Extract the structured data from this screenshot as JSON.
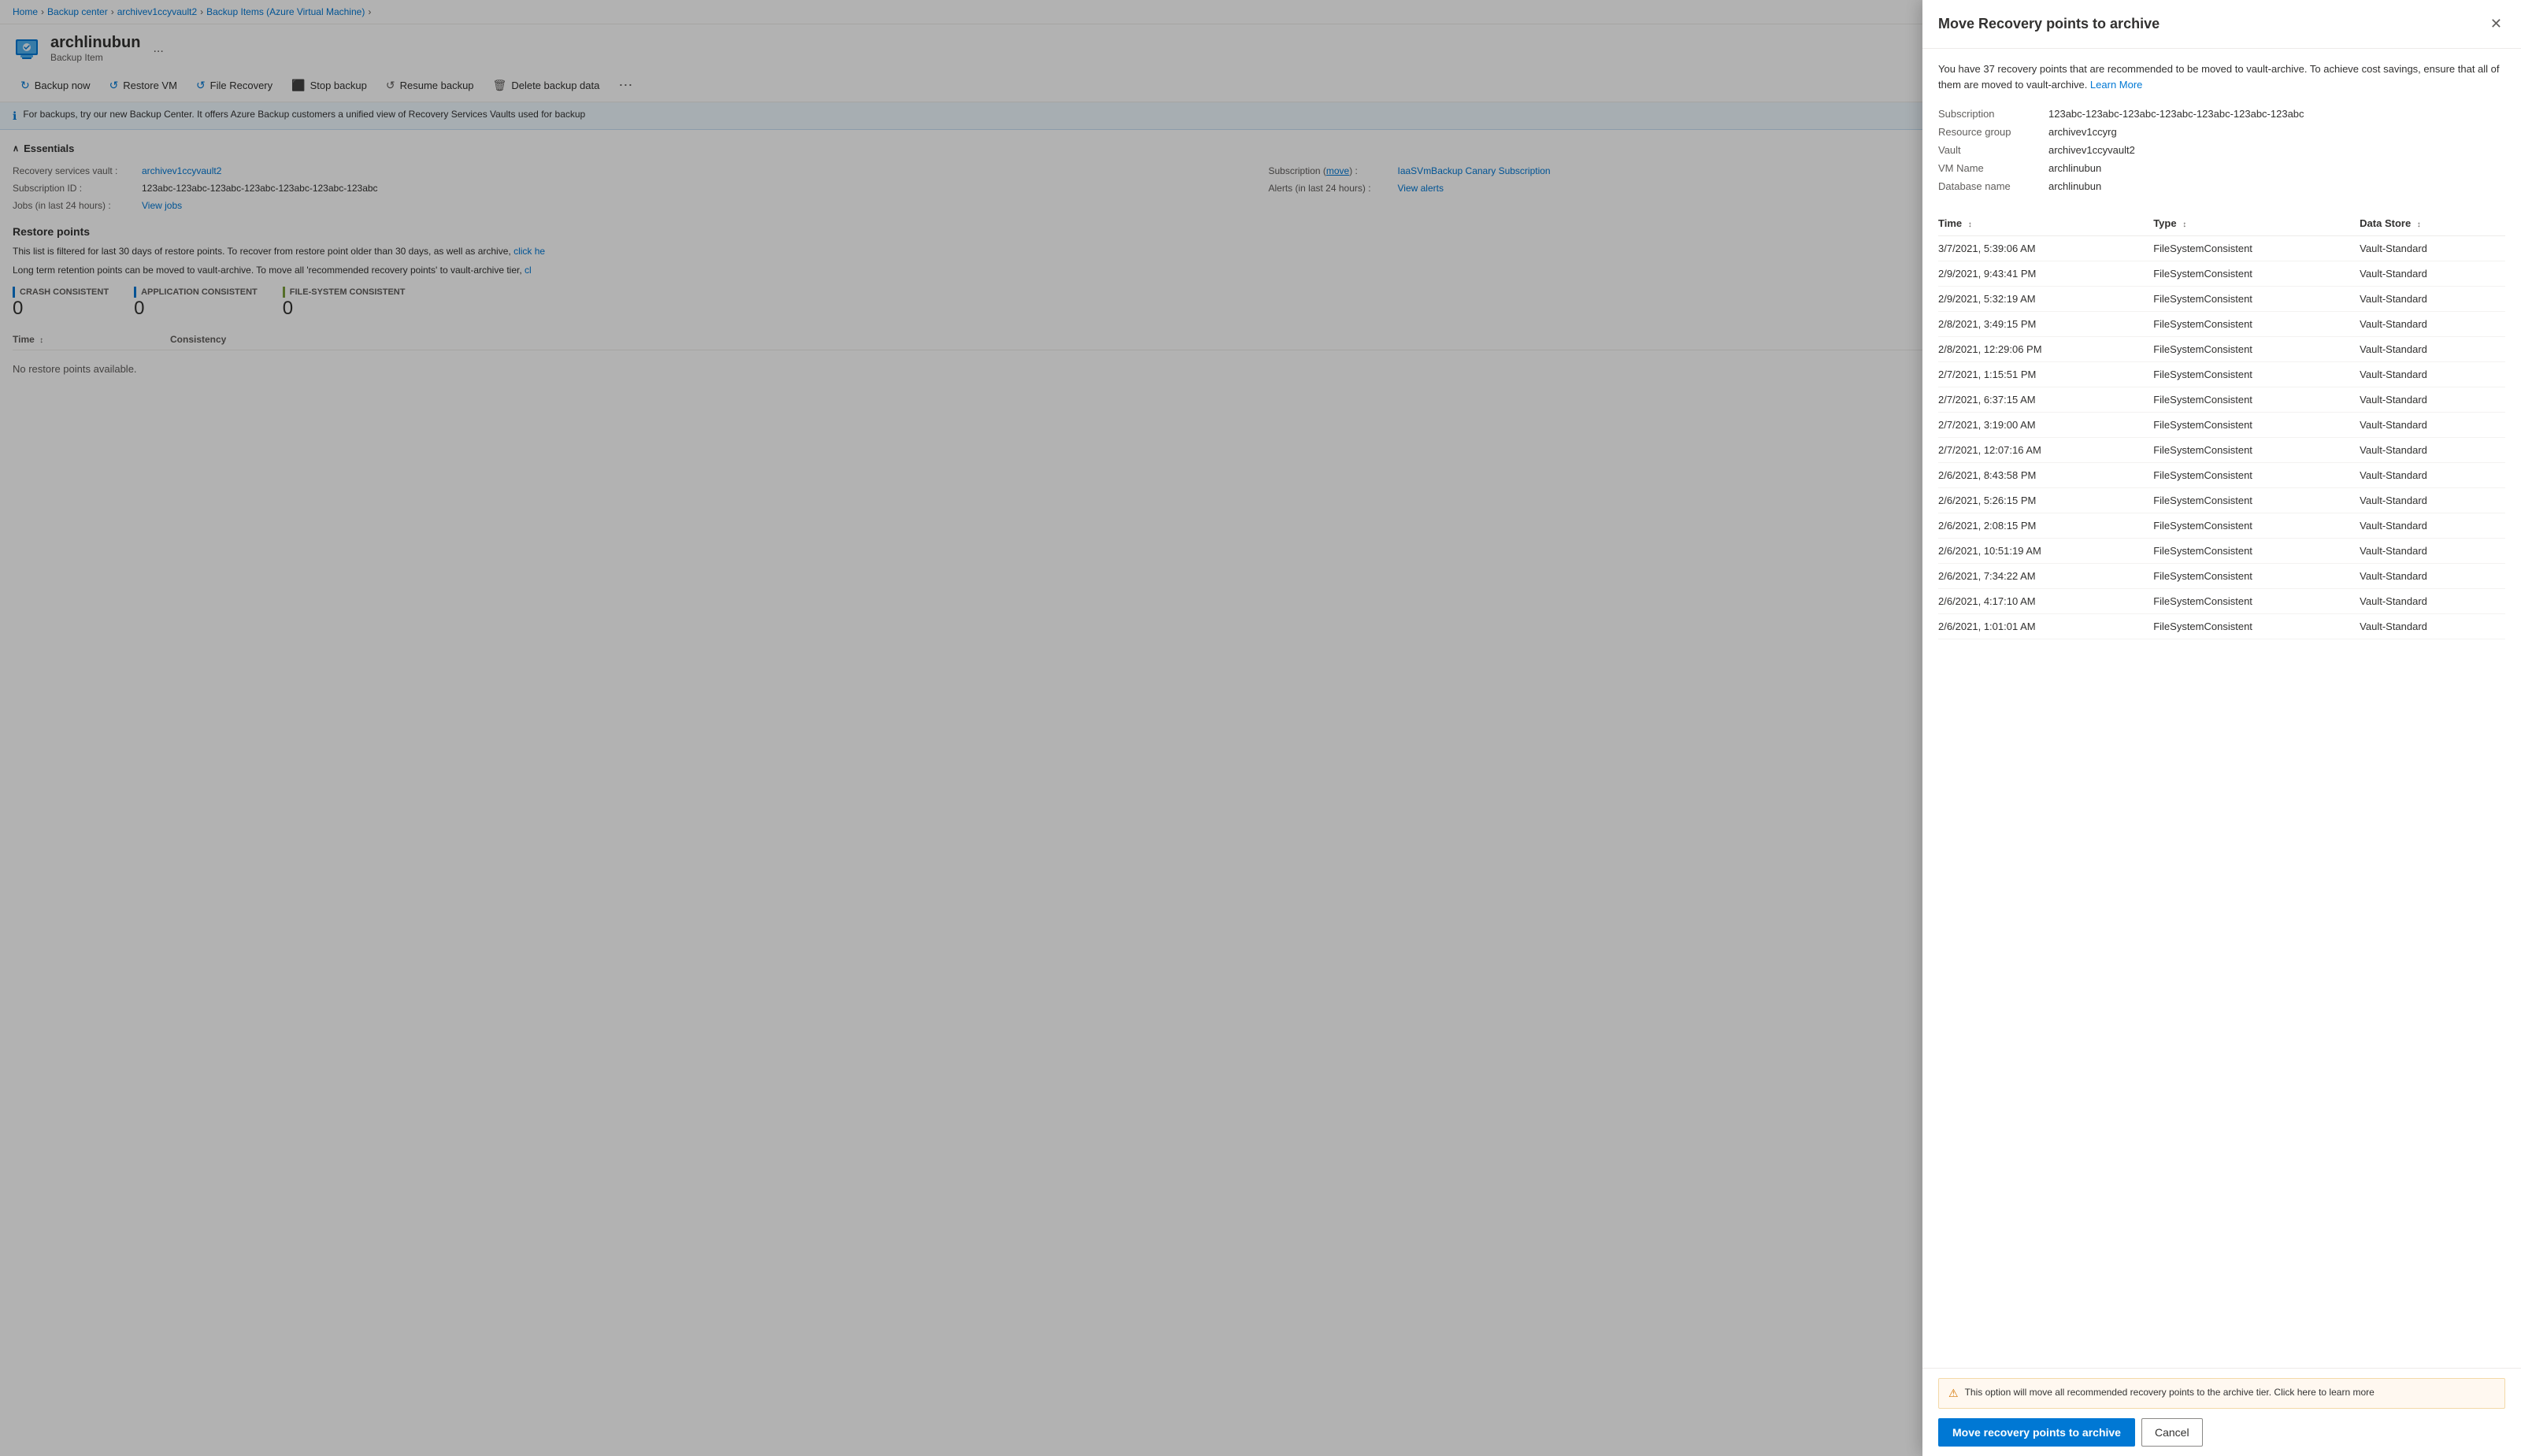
{
  "breadcrumb": {
    "items": [
      {
        "label": "Home",
        "href": "#"
      },
      {
        "label": "Backup center",
        "href": "#"
      },
      {
        "label": "archivev1ccyvault2",
        "href": "#"
      },
      {
        "label": "Backup Items (Azure Virtual Machine)",
        "href": "#"
      }
    ]
  },
  "header": {
    "title": "archlinubun",
    "subtitle": "Backup Item",
    "more_label": "..."
  },
  "toolbar": {
    "buttons": [
      {
        "id": "backup-now",
        "label": "Backup now",
        "icon": "↻"
      },
      {
        "id": "restore-vm",
        "label": "Restore VM",
        "icon": "↺"
      },
      {
        "id": "file-recovery",
        "label": "File Recovery",
        "icon": "↺"
      },
      {
        "id": "stop-backup",
        "label": "Stop backup",
        "icon": "⬛"
      },
      {
        "id": "resume-backup",
        "label": "Resume backup",
        "icon": "↺"
      },
      {
        "id": "delete-backup-data",
        "label": "Delete backup data",
        "icon": "🗑"
      },
      {
        "id": "more",
        "label": "",
        "icon": "…"
      }
    ]
  },
  "info_banner": {
    "text": "For backups, try our new Backup Center. It offers Azure Backup customers a unified view of Recovery Services Vaults used for backup"
  },
  "essentials": {
    "title": "Essentials",
    "fields": [
      {
        "label": "Recovery services vault",
        "value": "archivev1ccyvault2",
        "link": true
      },
      {
        "label": "Subscription",
        "value": "(move)",
        "extra": "IaaSVmBackup Canary Subscription",
        "link": true
      },
      {
        "label": "Subscription ID",
        "value": "123abc-123abc-123abc-123abc-123abc-123abc-123abc"
      },
      {
        "label": "Alerts (in last 24 hours)",
        "value": "View alerts",
        "link": true
      },
      {
        "label": "Jobs (in last 24 hours)",
        "value": "View jobs",
        "link": true
      }
    ]
  },
  "restore_points": {
    "title": "Restore points",
    "description1": "This list is filtered for last 30 days of restore points. To recover from restore point older than 30 days, as well as archive, click he",
    "description2": "Long term retention points can be moved to vault-archive. To move all 'recommended recovery points' to vault-archive tier, cl",
    "stats": [
      {
        "label": "CRASH CONSISTENT",
        "color": "#0078d4",
        "value": "0"
      },
      {
        "label": "APPLICATION CONSISTENT",
        "color": "#0078d4",
        "value": "0"
      },
      {
        "label": "FILE-SYSTEM CONSISTENT",
        "color": "#7a9f3c",
        "value": "0"
      }
    ],
    "columns": [
      {
        "label": "Time",
        "sortable": true
      },
      {
        "label": "Consistency",
        "sortable": false
      }
    ],
    "no_data_text": "No restore points available."
  },
  "panel": {
    "title": "Move Recovery points to archive",
    "description": "You have 37 recovery points that are recommended to be moved to vault-archive. To achieve cost savings, ensure that all of them are moved to vault-archive.",
    "learn_more_label": "Learn More",
    "info_rows": [
      {
        "label": "Subscription",
        "value": "123abc-123abc-123abc-123abc-123abc-123abc-123abc"
      },
      {
        "label": "Resource group",
        "value": "archivev1ccyrg"
      },
      {
        "label": "Vault",
        "value": "archivev1ccyvault2"
      },
      {
        "label": "VM Name",
        "value": "archlinubun"
      },
      {
        "label": "Database name",
        "value": "archlinubun"
      }
    ],
    "table": {
      "columns": [
        {
          "label": "Time",
          "sort": true
        },
        {
          "label": "Type",
          "sort": true
        },
        {
          "label": "Data Store",
          "sort": true
        }
      ],
      "rows": [
        {
          "time": "3/7/2021, 5:39:06 AM",
          "type": "FileSystemConsistent",
          "datastore": "Vault-Standard"
        },
        {
          "time": "2/9/2021, 9:43:41 PM",
          "type": "FileSystemConsistent",
          "datastore": "Vault-Standard"
        },
        {
          "time": "2/9/2021, 5:32:19 AM",
          "type": "FileSystemConsistent",
          "datastore": "Vault-Standard"
        },
        {
          "time": "2/8/2021, 3:49:15 PM",
          "type": "FileSystemConsistent",
          "datastore": "Vault-Standard"
        },
        {
          "time": "2/8/2021, 12:29:06 PM",
          "type": "FileSystemConsistent",
          "datastore": "Vault-Standard"
        },
        {
          "time": "2/7/2021, 1:15:51 PM",
          "type": "FileSystemConsistent",
          "datastore": "Vault-Standard"
        },
        {
          "time": "2/7/2021, 6:37:15 AM",
          "type": "FileSystemConsistent",
          "datastore": "Vault-Standard"
        },
        {
          "time": "2/7/2021, 3:19:00 AM",
          "type": "FileSystemConsistent",
          "datastore": "Vault-Standard"
        },
        {
          "time": "2/7/2021, 12:07:16 AM",
          "type": "FileSystemConsistent",
          "datastore": "Vault-Standard"
        },
        {
          "time": "2/6/2021, 8:43:58 PM",
          "type": "FileSystemConsistent",
          "datastore": "Vault-Standard"
        },
        {
          "time": "2/6/2021, 5:26:15 PM",
          "type": "FileSystemConsistent",
          "datastore": "Vault-Standard"
        },
        {
          "time": "2/6/2021, 2:08:15 PM",
          "type": "FileSystemConsistent",
          "datastore": "Vault-Standard"
        },
        {
          "time": "2/6/2021, 10:51:19 AM",
          "type": "FileSystemConsistent",
          "datastore": "Vault-Standard"
        },
        {
          "time": "2/6/2021, 7:34:22 AM",
          "type": "FileSystemConsistent",
          "datastore": "Vault-Standard"
        },
        {
          "time": "2/6/2021, 4:17:10 AM",
          "type": "FileSystemConsistent",
          "datastore": "Vault-Standard"
        },
        {
          "time": "2/6/2021, 1:01:01 AM",
          "type": "FileSystemConsistent",
          "datastore": "Vault-Standard"
        }
      ]
    },
    "warning_text": "This option will move all recommended recovery points to the archive tier. Click here to learn more",
    "action_btn_label": "Move recovery points to archive",
    "cancel_btn_label": "Cancel"
  }
}
